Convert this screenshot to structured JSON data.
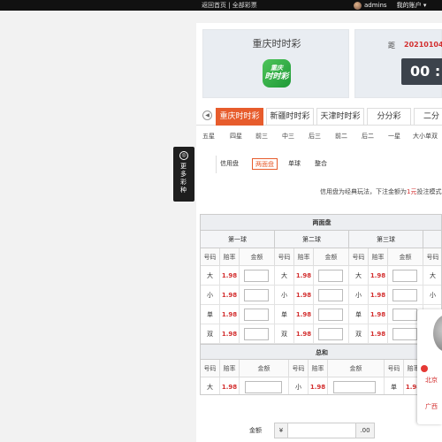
{
  "topbar": {
    "links": "返回首页 | 全部彩票",
    "username": "admins",
    "account": "我的账户 ▾"
  },
  "lottery": {
    "name": "重庆时时彩",
    "logo_small": "重庆",
    "logo_big": "时时彩"
  },
  "timer": {
    "label": "距",
    "issue": "20210104",
    "time": "00 :"
  },
  "tabs": [
    "重庆时时彩",
    "新疆时时彩",
    "天津时时彩",
    "分分彩",
    "二分"
  ],
  "tab_prev": "◀",
  "subtabs": [
    "五星",
    "四星",
    "前三",
    "中三",
    "后三",
    "前二",
    "后二",
    "一星",
    "大小单双"
  ],
  "side_button": {
    "icon": "◎",
    "text": "更多彩种"
  },
  "modes": {
    "label": "信用盘",
    "items": [
      "两面盘",
      "单球",
      "整合"
    ]
  },
  "note": {
    "before": "信用盘为经典玩法，下注金额为",
    "highlight": "1元",
    "after": "投注模式。"
  },
  "bet_table": {
    "title": "两面盘",
    "balls": [
      "第一球",
      "第二球",
      "第三球"
    ],
    "col_headers": [
      "号码",
      "赔率",
      "金额"
    ],
    "rows": [
      {
        "label": "大",
        "odds": "1.98"
      },
      {
        "label": "小",
        "odds": "1.98"
      },
      {
        "label": "单",
        "odds": "1.98"
      },
      {
        "label": "双",
        "odds": "1.98"
      }
    ],
    "sum_title": "总和",
    "sum_cells": [
      {
        "label": "大",
        "odds": "1.98"
      },
      {
        "label": "小",
        "odds": "1.98"
      },
      {
        "label": "单",
        "odds": "1.98"
      }
    ]
  },
  "amount": {
    "label": "金额",
    "currency": "¥",
    "decimal": ".00"
  },
  "chat": {
    "loc1": "北京",
    "loc2": "广西"
  }
}
